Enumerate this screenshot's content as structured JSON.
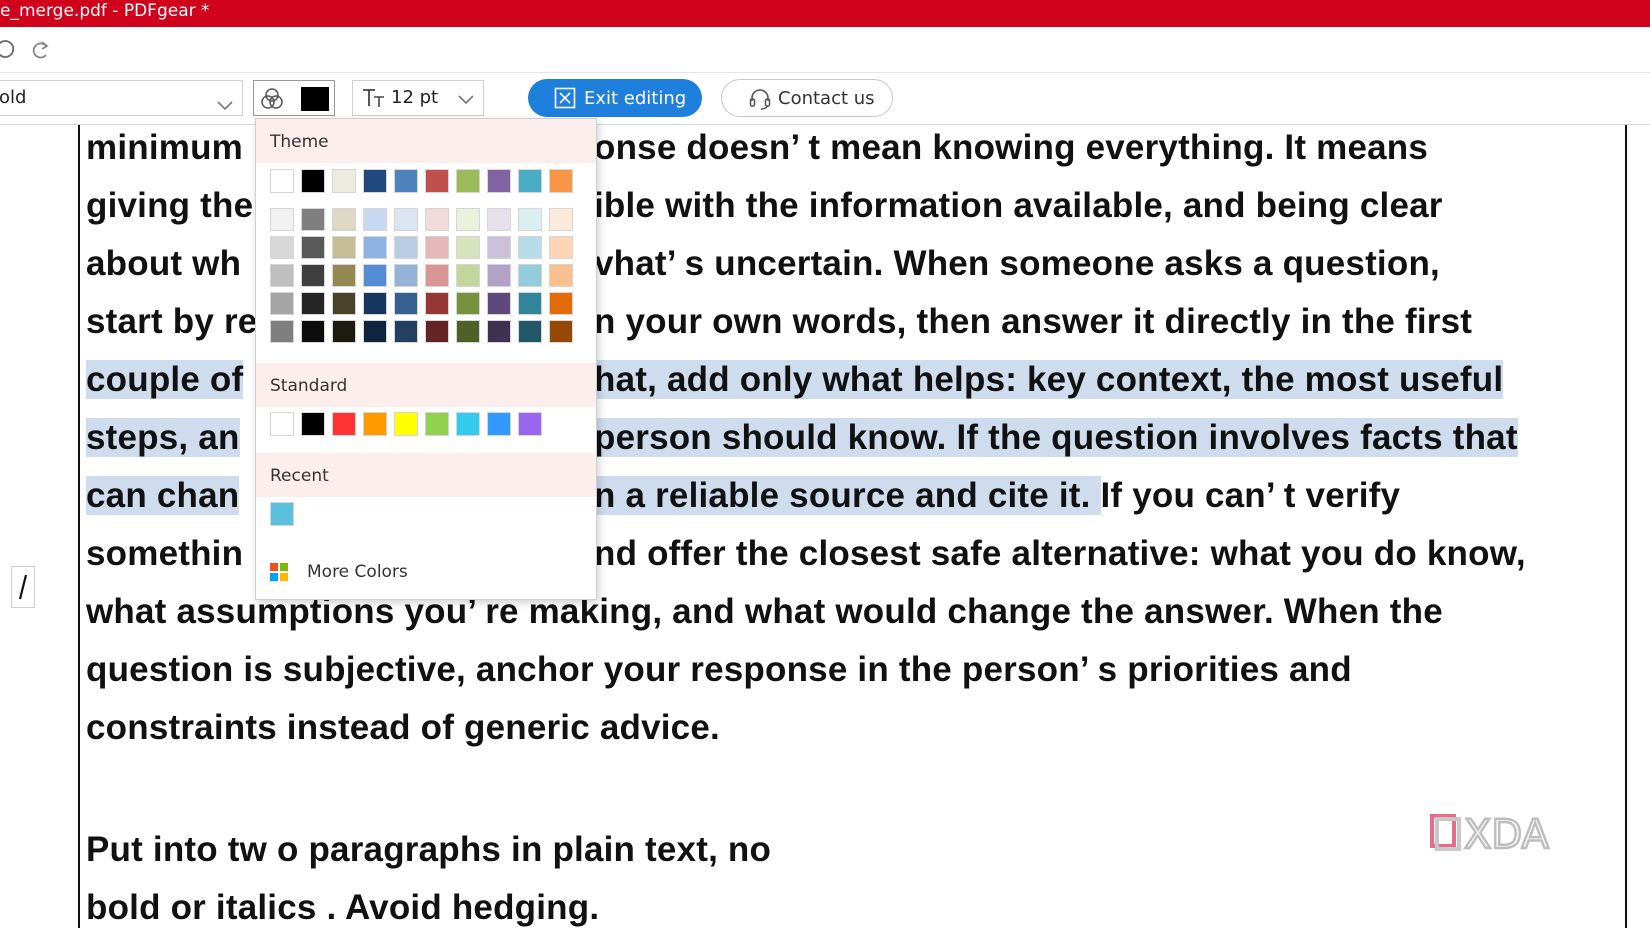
{
  "window": {
    "title": "e_merge.pdf - PDFgear *"
  },
  "quickbar": {
    "undo_icon": "undo-icon",
    "redo_icon": "redo-icon"
  },
  "toolbar": {
    "font_value": "old",
    "color_picker": {
      "icon": "color-wheel-icon",
      "current_color": "#000000"
    },
    "font_size": {
      "icon": "text-size-icon",
      "label": "TT",
      "value": "12 pt"
    },
    "exit_editing_label": "Exit editing",
    "contact_us_label": "Contact us"
  },
  "color_dropdown": {
    "theme_label": "Theme",
    "standard_label": "Standard",
    "recent_label": "Recent",
    "more_colors_label": "More Colors",
    "theme_base": [
      "#ffffff",
      "#000000",
      "#eeece1",
      "#1f497d",
      "#4f81bd",
      "#c0504d",
      "#9bbb59",
      "#8064a2",
      "#4bacc6",
      "#f79646"
    ],
    "theme_tints": [
      [
        "#f2f2f2",
        "#7f7f7f",
        "#ddd9c3",
        "#c6d9f0",
        "#dbe5f1",
        "#f2dcdb",
        "#ebf1dd",
        "#e5e0ec",
        "#dbeef3",
        "#fdeada"
      ],
      [
        "#d8d8d8",
        "#595959",
        "#c4bd97",
        "#8db3e2",
        "#b8cce4",
        "#e5b9b7",
        "#d7e3bc",
        "#ccc1d9",
        "#b7dde8",
        "#fbd5b5"
      ],
      [
        "#bfbfbf",
        "#3f3f3f",
        "#938953",
        "#548dd4",
        "#95b3d7",
        "#d99694",
        "#c3d69b",
        "#b2a2c7",
        "#92cddc",
        "#fac08f"
      ],
      [
        "#a5a5a5",
        "#262626",
        "#494429",
        "#17365d",
        "#366092",
        "#953734",
        "#76923c",
        "#5f497a",
        "#31859b",
        "#e36c09"
      ],
      [
        "#7f7f7f",
        "#0c0c0c",
        "#1d1b10",
        "#0f243e",
        "#244061",
        "#632423",
        "#4f6128",
        "#3f3151",
        "#205867",
        "#974806"
      ]
    ],
    "standard": [
      "#ffffff",
      "#000000",
      "#ff3333",
      "#ff9900",
      "#ffff00",
      "#92d050",
      "#33ccee",
      "#3399ff",
      "#9966ee"
    ],
    "recent": [
      "#5bc0de"
    ]
  },
  "document": {
    "lines": [
      {
        "pre": "minimum",
        "hl": "",
        "post": ""
      },
      {
        "pre": "giving the",
        "hl": "",
        "post": ""
      },
      {
        "pre": "about wh",
        "hl": "",
        "post": ""
      },
      {
        "pre": "start by re",
        "hl": "",
        "post": ""
      },
      {
        "pre": "",
        "hl": "couple of",
        "post": ""
      },
      {
        "pre": "",
        "hl": "steps, an",
        "post": ""
      },
      {
        "pre": "",
        "hl": "can chan",
        "post": ""
      },
      {
        "pre": "somethin",
        "hl": "",
        "post": ""
      },
      {
        "pre": "what assumptions you’ re making, and what would change the answer. When the",
        "hl": "",
        "post": ""
      },
      {
        "pre": "question is subjective, anchor your response in the person’ s priorities and",
        "hl": "",
        "post": ""
      },
      {
        "pre": "constraints instead of generic advice.",
        "hl": "",
        "post": ""
      },
      {
        "pre": "Put into tw o paragraphs in plain text, no",
        "hl": "",
        "post": ""
      },
      {
        "pre": "bold or italics . Avoid hedging.",
        "hl": "",
        "post": ""
      }
    ],
    "right_fragments": [
      {
        "pre": "onse doesn’ t mean knowing everything. It means",
        "hl": "",
        "post": ""
      },
      {
        "pre": "ible with the information available, and being clear",
        "hl": "",
        "post": ""
      },
      {
        "pre": "vhat’ s uncertain. When someone asks a question,",
        "hl": "",
        "post": ""
      },
      {
        "pre": "n your own words, then answer it directly in the first",
        "hl": "",
        "post": ""
      },
      {
        "pre": "",
        "hl": "hat, add only what helps: key context, the most useful",
        "post": ""
      },
      {
        "pre": "",
        "hl": " person should know. If the question involves facts that",
        "post": ""
      },
      {
        "pre": "",
        "hl": "n a reliable source and cite it. ",
        "post": "If you can’ t verify"
      },
      {
        "pre": "nd offer the closest safe alternative: what you do know,",
        "hl": "",
        "post": ""
      }
    ]
  },
  "side_icon": "text-cursor-icon",
  "watermark": {
    "text": "XDA"
  }
}
